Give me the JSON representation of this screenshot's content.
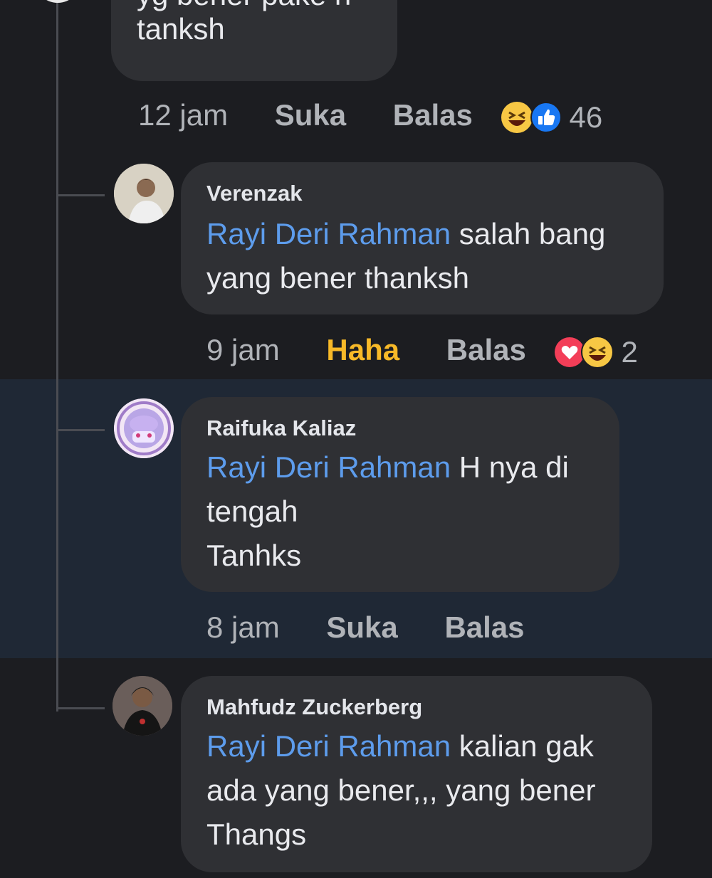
{
  "thread": {
    "top_comment": {
      "partial_line": "yg bener pake h",
      "last_line": "tanksh",
      "time": "12 jam",
      "like_label": "Suka",
      "reply_label": "Balas",
      "reactions": [
        "haha-emoji-icon",
        "like-emoji-icon"
      ],
      "reaction_count": "46"
    },
    "replies": [
      {
        "author": "Verenzak",
        "mention": "Rayi Deri Rahman",
        "text_line1": " salah bang",
        "text_line2": "yang bener thanksh",
        "time": "9 jam",
        "like_label": "Haha",
        "reply_label": "Balas",
        "reactions": [
          "love-emoji-icon",
          "haha-emoji-icon"
        ],
        "reaction_count": "2"
      },
      {
        "author": "Raifuka Kaliaz",
        "mention": "Rayi Deri Rahman",
        "text_line1": " H nya di",
        "text_line2": "tengah",
        "text_line3": "Tanhks",
        "time": "8 jam",
        "like_label": "Suka",
        "reply_label": "Balas"
      },
      {
        "author": "Mahfudz Zuckerberg",
        "mention": "Rayi Deri Rahman",
        "text_line1": " kalian gak",
        "text_line2": "ada yang bener,,, yang bener",
        "text_line3": "Thangs"
      }
    ]
  },
  "colors": {
    "background": "#1c1d21",
    "highlight": "#1f2835",
    "bubble": "#2f3034",
    "mention": "#5d9cec",
    "haha_active": "#f7b928"
  }
}
